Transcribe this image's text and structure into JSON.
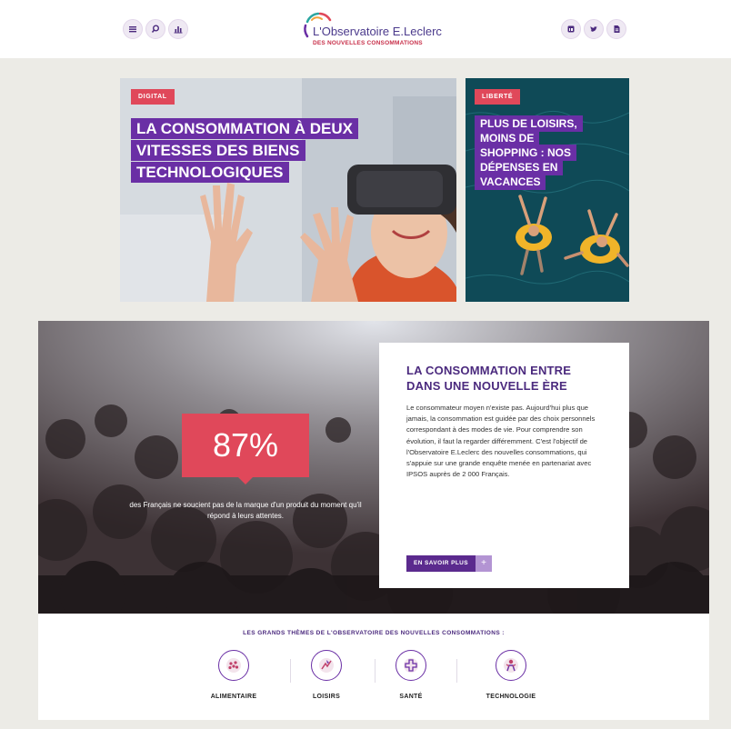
{
  "header": {
    "left_icons": [
      "menu-icon",
      "search-icon",
      "chart-icon"
    ],
    "right_icons": [
      "linkedin-icon",
      "twitter-icon",
      "document-icon"
    ],
    "logo": {
      "name": "L'Observatoire E.Leclerc",
      "subtitle": "DES NOUVELLES CONSOMMATIONS"
    },
    "accent_color": "#6a2fa5",
    "red_color": "#e0485a"
  },
  "featured": [
    {
      "tag": "DIGITAL",
      "headline": "LA CONSOMMATION À DEUX VITESSES DES BIENS TECHNOLOGIQUES"
    },
    {
      "tag": "LIBERTÉ",
      "headline": "PLUS DE LOISIRS, MOINS DE SHOPPING : NOS DÉPENSES EN VACANCES"
    }
  ],
  "hero": {
    "stat": "87%",
    "stat_text": "des Français ne soucient pas de la marque d'un produit du moment qu'il répond à leurs attentes.",
    "panel_title": "LA CONSOMMATION ENTRE DANS UNE NOUVELLE ÈRE",
    "panel_body": "Le consommateur moyen n'existe pas. Aujourd'hui plus que jamais, la consommation est guidée par des choix personnels correspondant à des modes de vie. Pour comprendre son évolution, il faut la regarder différemment. C'est l'objectif de l'Observatoire E.Leclerc des nouvelles consommations, qui s'appuie sur une grande enquête menée en partenariat avec IPSOS auprès de 2 000 Français.",
    "button_label": "EN SAVOIR PLUS",
    "button_plus": "+"
  },
  "themes": {
    "title": "LES GRANDS THÈMES DE L'OBSERVATOIRE DES NOUVELLES CONSOMMATIONS :",
    "items": [
      {
        "label": "ALIMENTAIRE",
        "icon": "food-icon"
      },
      {
        "label": "LOISIRS",
        "icon": "leisure-icon"
      },
      {
        "label": "SANTÉ",
        "icon": "health-icon"
      },
      {
        "label": "TECHNOLOGIE",
        "icon": "technology-icon"
      }
    ]
  }
}
